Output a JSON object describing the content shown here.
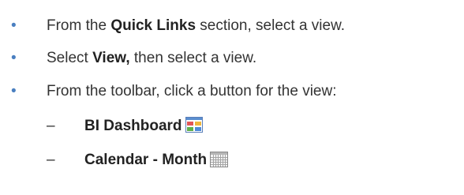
{
  "list": {
    "bullet_symbol": "•",
    "items": [
      {
        "prefix": "From the ",
        "bold": "Quick Links",
        "suffix": " section, select a view."
      },
      {
        "prefix": "Select ",
        "bold": "View,",
        "suffix": " then select a view."
      },
      {
        "prefix": "From the toolbar, click a button for the view:",
        "bold": "",
        "suffix": ""
      }
    ],
    "subitems": [
      {
        "dash": "–",
        "label": "BI Dashboard",
        "icon": "bi-dashboard-icon"
      },
      {
        "dash": "–",
        "label": "Calendar - Month",
        "icon": "calendar-month-icon"
      }
    ]
  },
  "colors": {
    "bullet": "#4a7fc0",
    "text": "#333333"
  }
}
